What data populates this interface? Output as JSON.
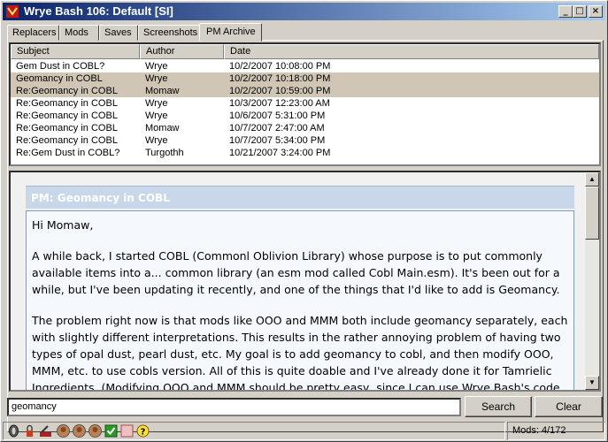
{
  "window": {
    "title": "Wrye Bash 106: Default [SI]",
    "min_glyph": "_",
    "max_glyph": "□",
    "close_glyph": "×"
  },
  "tabs": [
    {
      "label": "Replacers"
    },
    {
      "label": "Mods"
    },
    {
      "label": "Saves"
    },
    {
      "label": "Screenshots"
    },
    {
      "label": "PM Archive",
      "active": true
    }
  ],
  "list": {
    "columns": [
      "Subject",
      "Author",
      "Date"
    ],
    "rows": [
      {
        "subject": "Gem Dust in COBL?",
        "author": "Wrye",
        "date": "10/2/2007 10:08:00 PM",
        "selected": false
      },
      {
        "subject": "Geomancy in COBL",
        "author": "Wrye",
        "date": "10/2/2007 10:18:00 PM",
        "selected": true
      },
      {
        "subject": "Re:Geomancy in COBL",
        "author": "Momaw",
        "date": "10/2/2007 10:59:00 PM",
        "selected": true
      },
      {
        "subject": "Re:Geomancy in COBL",
        "author": "Wrye",
        "date": "10/3/2007 12:23:00 AM",
        "selected": false
      },
      {
        "subject": "Re:Geomancy in COBL",
        "author": "Wrye",
        "date": "10/6/2007 5:31:00 PM",
        "selected": false
      },
      {
        "subject": "Re:Geomancy in COBL",
        "author": "Momaw",
        "date": "10/7/2007 2:47:00 AM",
        "selected": false
      },
      {
        "subject": "Re:Geomancy in COBL",
        "author": "Wrye",
        "date": "10/7/2007 5:34:00 PM",
        "selected": false
      },
      {
        "subject": "Re:Gem Dust in COBL?",
        "author": "Turgothh",
        "date": "10/21/2007 3:24:00 PM",
        "selected": false
      }
    ]
  },
  "message": {
    "title": "PM: Geomancy in COBL",
    "paragraphs": [
      "Hi Momaw,",
      "A while back, I started COBL (Commonl Oblivion Library) whose purpose is to put commonly available items into a... common library (an esm mod called Cobl Main.esm). It's been out for a while, but I've been updating it recently, and one of the things that I'd like to add is Geomancy.",
      "The problem right now is that mods like OOO and MMM both include geomancy separately, each with slightly different interpretations. This results in the rather annoying problem of having two types of opal dust, pearl dust, etc. My goal is to add geomancy to cobl, and then modify OOO, MMM, etc. to use cobls version. All of this is quite doable and I've already done it for Tamrielic Ingredients. (Modifying OOO and MMM should be pretty easy, since I can use Wrye Bash's code"
    ]
  },
  "search": {
    "value": "geomancy",
    "search_label": "Search",
    "clear_label": "Clear"
  },
  "status": {
    "icons": [
      "oblivion-icon",
      "lock-icon",
      "settings-icon",
      "bust-icon-1",
      "bust-icon-2",
      "bust-icon-3",
      "check-icon",
      "box-icon",
      "help-icon"
    ],
    "mods_text": "Mods: 4/172"
  }
}
